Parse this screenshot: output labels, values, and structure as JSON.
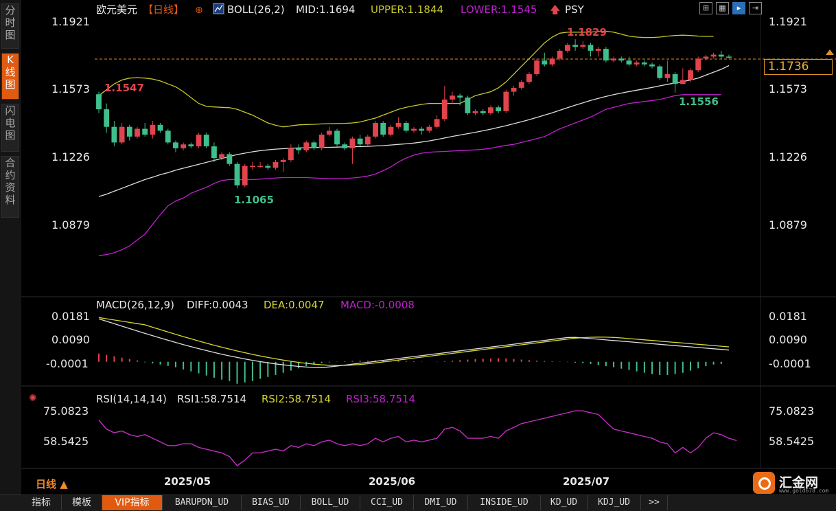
{
  "left_tabs": [
    {
      "id": "fenshi",
      "label": "分时图"
    },
    {
      "id": "kline",
      "label": "K线图"
    },
    {
      "id": "shandian",
      "label": "闪电图"
    },
    {
      "id": "heyue",
      "label": "合约资料"
    }
  ],
  "header": {
    "symbol": "欧元美元",
    "period_tag": "【日线】",
    "plus_icon": "⊕",
    "boll": "BOLL(26,2)",
    "mid": "MID:1.1694",
    "upper": "UPPER:1.1844",
    "lower": "LOWER:1.1545",
    "psy": "PSY"
  },
  "toolbar_icons": [
    "grid-icon",
    "table-icon",
    "cursor-icon",
    "exit-icon"
  ],
  "price_panel": {
    "ticks": [
      "1.1921",
      "1.1573",
      "1.1226",
      "1.0879"
    ],
    "current_price": "1.1736",
    "annotations": {
      "start": "1.1547",
      "low": "1.1065",
      "high": "1.1829",
      "recent_low": "1.1556"
    }
  },
  "macd_panel": {
    "title": "MACD(26,12,9)",
    "diff": "DIFF:0.0043",
    "dea": "DEA:0.0047",
    "macd": "MACD:-0.0008",
    "ticks": [
      "0.0181",
      "0.0090",
      "-0.0001"
    ]
  },
  "rsi_panel": {
    "title": "RSI(14,14,14)",
    "rsi1": "RSI1:58.7514",
    "rsi2": "RSI2:58.7514",
    "rsi3": "RSI3:58.7514",
    "ticks": [
      "75.0823",
      "58.5425"
    ]
  },
  "x_labels": [
    "2025/05",
    "2025/06",
    "2025/07"
  ],
  "period_label": "日线 ▲",
  "bottom_tabs": [
    "指标",
    "模板",
    "VIP指标",
    "BARUPDN_UD",
    "BIAS_UD",
    "BOLL_UD",
    "CCI_UD",
    "DMI_UD",
    "INSIDE_UD",
    "KD_UD",
    "KDJ_UD",
    ">>"
  ],
  "logo": {
    "name": "汇金网",
    "url": "www.gold678.com"
  },
  "colors": {
    "up": "#e0444c",
    "down": "#3fbf8c",
    "mid": "#dddddd",
    "upper": "#c8c828",
    "lower": "#c020d0",
    "dea": "#d8d830",
    "rsi": "#c030c0",
    "accent": "#e05a10"
  },
  "chart_data": {
    "type": "candlestick",
    "y_range_main": [
      1.07,
      1.2
    ],
    "candles": [
      [
        1.1547,
        1.147,
        1.156,
        1.145
      ],
      [
        1.147,
        1.138,
        1.15,
        1.135
      ],
      [
        1.138,
        1.13,
        1.141,
        1.128
      ],
      [
        1.13,
        1.138,
        1.14,
        1.129
      ],
      [
        1.138,
        1.133,
        1.139,
        1.131
      ],
      [
        1.133,
        1.137,
        1.138,
        1.132
      ],
      [
        1.137,
        1.134,
        1.14,
        1.133
      ],
      [
        1.134,
        1.139,
        1.141,
        1.132
      ],
      [
        1.139,
        1.136,
        1.14,
        1.135
      ],
      [
        1.136,
        1.13,
        1.137,
        1.129
      ],
      [
        1.13,
        1.127,
        1.131,
        1.125
      ],
      [
        1.127,
        1.129,
        1.13,
        1.126
      ],
      [
        1.129,
        1.128,
        1.13,
        1.127
      ],
      [
        1.128,
        1.134,
        1.135,
        1.127
      ],
      [
        1.134,
        1.128,
        1.135,
        1.127
      ],
      [
        1.128,
        1.122,
        1.13,
        1.12
      ],
      [
        1.122,
        1.124,
        1.125,
        1.121
      ],
      [
        1.124,
        1.119,
        1.125,
        1.118
      ],
      [
        1.119,
        1.108,
        1.12,
        1.1065
      ],
      [
        1.108,
        1.118,
        1.119,
        1.107
      ],
      [
        1.118,
        1.118,
        1.12,
        1.116
      ],
      [
        1.118,
        1.118,
        1.12,
        1.117
      ],
      [
        1.118,
        1.117,
        1.119,
        1.116
      ],
      [
        1.117,
        1.12,
        1.121,
        1.116
      ],
      [
        1.12,
        1.121,
        1.122,
        1.115
      ],
      [
        1.121,
        1.127,
        1.129,
        1.12
      ],
      [
        1.127,
        1.126,
        1.129,
        1.124
      ],
      [
        1.126,
        1.13,
        1.131,
        1.125
      ],
      [
        1.13,
        1.127,
        1.131,
        1.126
      ],
      [
        1.127,
        1.134,
        1.135,
        1.126
      ],
      [
        1.134,
        1.136,
        1.138,
        1.133
      ],
      [
        1.136,
        1.129,
        1.137,
        1.128
      ],
      [
        1.129,
        1.127,
        1.13,
        1.126
      ],
      [
        1.127,
        1.132,
        1.133,
        1.119
      ],
      [
        1.132,
        1.129,
        1.134,
        1.128
      ],
      [
        1.129,
        1.133,
        1.134,
        1.128
      ],
      [
        1.133,
        1.14,
        1.141,
        1.132
      ],
      [
        1.14,
        1.134,
        1.141,
        1.133
      ],
      [
        1.134,
        1.138,
        1.139,
        1.133
      ],
      [
        1.138,
        1.14,
        1.143,
        1.137
      ],
      [
        1.14,
        1.136,
        1.141,
        1.135
      ],
      [
        1.136,
        1.137,
        1.138,
        1.135
      ],
      [
        1.137,
        1.136,
        1.138,
        1.134
      ],
      [
        1.136,
        1.138,
        1.139,
        1.135
      ],
      [
        1.138,
        1.142,
        1.144,
        1.137
      ],
      [
        1.142,
        1.152,
        1.159,
        1.141
      ],
      [
        1.152,
        1.154,
        1.156,
        1.15
      ],
      [
        1.154,
        1.153,
        1.155,
        1.149
      ],
      [
        1.153,
        1.145,
        1.154,
        1.144
      ],
      [
        1.145,
        1.146,
        1.147,
        1.144
      ],
      [
        1.146,
        1.145,
        1.147,
        1.144
      ],
      [
        1.145,
        1.148,
        1.149,
        1.144
      ],
      [
        1.148,
        1.146,
        1.149,
        1.145
      ],
      [
        1.146,
        1.156,
        1.157,
        1.145
      ],
      [
        1.156,
        1.158,
        1.159,
        1.154
      ],
      [
        1.158,
        1.161,
        1.162,
        1.157
      ],
      [
        1.161,
        1.165,
        1.166,
        1.16
      ],
      [
        1.165,
        1.172,
        1.173,
        1.164
      ],
      [
        1.172,
        1.17,
        1.176,
        1.169
      ],
      [
        1.17,
        1.173,
        1.174,
        1.169
      ],
      [
        1.173,
        1.177,
        1.178,
        1.172
      ],
      [
        1.177,
        1.18,
        1.181,
        1.176
      ],
      [
        1.18,
        1.179,
        1.1829,
        1.177
      ],
      [
        1.179,
        1.18,
        1.182,
        1.178
      ],
      [
        1.18,
        1.177,
        1.181,
        1.174
      ],
      [
        1.177,
        1.178,
        1.179,
        1.174
      ],
      [
        1.178,
        1.172,
        1.179,
        1.171
      ],
      [
        1.172,
        1.173,
        1.174,
        1.171
      ],
      [
        1.173,
        1.172,
        1.174,
        1.171
      ],
      [
        1.172,
        1.17,
        1.174,
        1.169
      ],
      [
        1.17,
        1.171,
        1.172,
        1.169
      ],
      [
        1.171,
        1.17,
        1.172,
        1.169
      ],
      [
        1.17,
        1.169,
        1.171,
        1.168
      ],
      [
        1.169,
        1.163,
        1.17,
        1.162
      ],
      [
        1.163,
        1.165,
        1.172,
        1.161
      ],
      [
        1.165,
        1.16,
        1.166,
        1.1556
      ],
      [
        1.16,
        1.162,
        1.168,
        1.16
      ],
      [
        1.162,
        1.167,
        1.168,
        1.161
      ],
      [
        1.167,
        1.173,
        1.174,
        1.166
      ],
      [
        1.173,
        1.174,
        1.175,
        1.172
      ],
      [
        1.174,
        1.175,
        1.176,
        1.173
      ],
      [
        1.175,
        1.174,
        1.177,
        1.173
      ],
      [
        1.174,
        1.1736,
        1.175,
        1.173
      ]
    ],
    "macd_hist": [
      0.003,
      0.0025,
      0.002,
      0.0015,
      0.001,
      0.0005,
      -0.0002,
      -0.0006,
      -0.001,
      -0.0015,
      -0.002,
      -0.0028,
      -0.0035,
      -0.0042,
      -0.005,
      -0.0058,
      -0.0065,
      -0.007,
      -0.008,
      -0.0075,
      -0.007,
      -0.0062,
      -0.0055,
      -0.0048,
      -0.004,
      -0.0032,
      -0.0024,
      -0.0016,
      -0.001,
      -0.0005,
      -0.0002,
      0.0001,
      0.0002,
      0.0003,
      0.0004,
      0.0004,
      0.0005,
      0.0006,
      0.0005,
      0.0004,
      0.0003,
      0.0002,
      0.0001,
      0.0,
      -0.0001,
      0.0002,
      0.0004,
      0.0006,
      0.0008,
      0.001,
      0.0011,
      0.0012,
      0.0013,
      0.0012,
      0.001,
      0.0008,
      0.0006,
      0.0004,
      0.0003,
      0.0002,
      0.0001,
      -0.0001,
      -0.0003,
      -0.0005,
      -0.0008,
      -0.0012,
      -0.0016,
      -0.002,
      -0.0025,
      -0.003,
      -0.0035,
      -0.004,
      -0.0045,
      -0.0048,
      -0.0048,
      -0.0045,
      -0.004,
      -0.0032,
      -0.0024,
      -0.0016,
      -0.001,
      -0.0008
    ],
    "rsi": [
      70,
      65,
      63,
      64,
      62,
      61,
      62,
      60,
      58,
      56,
      56,
      57,
      57,
      55,
      54,
      53,
      52,
      50,
      45,
      48,
      52,
      52,
      53,
      54,
      53,
      56,
      55,
      57,
      56,
      58,
      59,
      57,
      56,
      57,
      56,
      57,
      60,
      58,
      60,
      61,
      58,
      59,
      58,
      59,
      60,
      65,
      66,
      64,
      60,
      60,
      60,
      61,
      60,
      64,
      66,
      68,
      69,
      70,
      71,
      72,
      73,
      74,
      75,
      75,
      74,
      73,
      69,
      65,
      64,
      63,
      62,
      61,
      60,
      58,
      57,
      52,
      55,
      52,
      55,
      60,
      63,
      62,
      60,
      58.75
    ],
    "mid_line": [
      1.1023,
      1.1035,
      1.105,
      1.1065,
      1.108,
      1.1095,
      1.111,
      1.1122,
      1.1135,
      1.1145,
      1.1158,
      1.1168,
      1.1178,
      1.1188,
      1.1198,
      1.1208,
      1.1218,
      1.1228,
      1.1238,
      1.1245,
      1.1252,
      1.1258,
      1.1262,
      1.1266,
      1.1268,
      1.127,
      1.1272,
      1.1273,
      1.1274,
      1.1275,
      1.1275,
      1.1276,
      1.1277,
      1.1278,
      1.1279,
      1.128,
      1.1282,
      1.1284,
      1.1287,
      1.129,
      1.1293,
      1.1297,
      1.1302,
      1.1308,
      1.1315,
      1.1323,
      1.1331,
      1.1338,
      1.1345,
      1.1352,
      1.136,
      1.1368,
      1.1377,
      1.1386,
      1.1396,
      1.1406,
      1.1417,
      1.1428,
      1.144,
      1.1452,
      1.1465,
      1.1478,
      1.1491,
      1.1503,
      1.1515,
      1.1526,
      1.1536,
      1.1545,
      1.1553,
      1.1561,
      1.1568,
      1.1575,
      1.1582,
      1.159,
      1.1598,
      1.1605,
      1.1612,
      1.162,
      1.163,
      1.1645,
      1.166,
      1.1675,
      1.1694
    ],
    "upper_line": [
      1.154,
      1.157,
      1.16,
      1.162,
      1.163,
      1.1632,
      1.163,
      1.1625,
      1.1615,
      1.16,
      1.1585,
      1.156,
      1.153,
      1.15,
      1.1485,
      1.1482,
      1.148,
      1.1478,
      1.147,
      1.1455,
      1.144,
      1.142,
      1.14,
      1.1388,
      1.138,
      1.1385,
      1.139,
      1.1392,
      1.1393,
      1.1395,
      1.1396,
      1.1397,
      1.1398,
      1.14,
      1.1405,
      1.1415,
      1.1425,
      1.144,
      1.1455,
      1.147,
      1.148,
      1.1488,
      1.1495,
      1.15,
      1.15,
      1.15,
      1.15,
      1.15,
      1.152,
      1.154,
      1.155,
      1.156,
      1.158,
      1.161,
      1.165,
      1.169,
      1.173,
      1.177,
      1.181,
      1.184,
      1.186,
      1.1865,
      1.1865,
      1.1865,
      1.1866,
      1.1868,
      1.187,
      1.1865,
      1.1855,
      1.1845,
      1.184,
      1.1838,
      1.1838,
      1.184,
      1.1845,
      1.1848,
      1.185,
      1.1848,
      1.1845,
      1.1844,
      1.1844
    ],
    "lower_line": [
      1.072,
      1.0725,
      1.0735,
      1.075,
      1.077,
      1.08,
      1.083,
      1.088,
      1.093,
      1.0975,
      1.1,
      1.1015,
      1.104,
      1.1055,
      1.107,
      1.109,
      1.1105,
      1.111,
      1.111,
      1.1108,
      1.111,
      1.1112,
      1.1115,
      1.1118,
      1.112,
      1.112,
      1.112,
      1.112,
      1.1118,
      1.1116,
      1.1115,
      1.1115,
      1.1115,
      1.1118,
      1.1122,
      1.1128,
      1.1138,
      1.1155,
      1.1175,
      1.12,
      1.122,
      1.1235,
      1.1245,
      1.125,
      1.1252,
      1.1254,
      1.1256,
      1.1258,
      1.126,
      1.1262,
      1.1265,
      1.127,
      1.1278,
      1.1285,
      1.129,
      1.13,
      1.131,
      1.132,
      1.133,
      1.135,
      1.137,
      1.1385,
      1.14,
      1.1415,
      1.143,
      1.145,
      1.147,
      1.148,
      1.149,
      1.15,
      1.1505,
      1.151,
      1.1515,
      1.152,
      1.153,
      1.154,
      1.1545,
      1.1545,
      1.1545,
      1.1545,
      1.1545,
      1.1545
    ]
  }
}
